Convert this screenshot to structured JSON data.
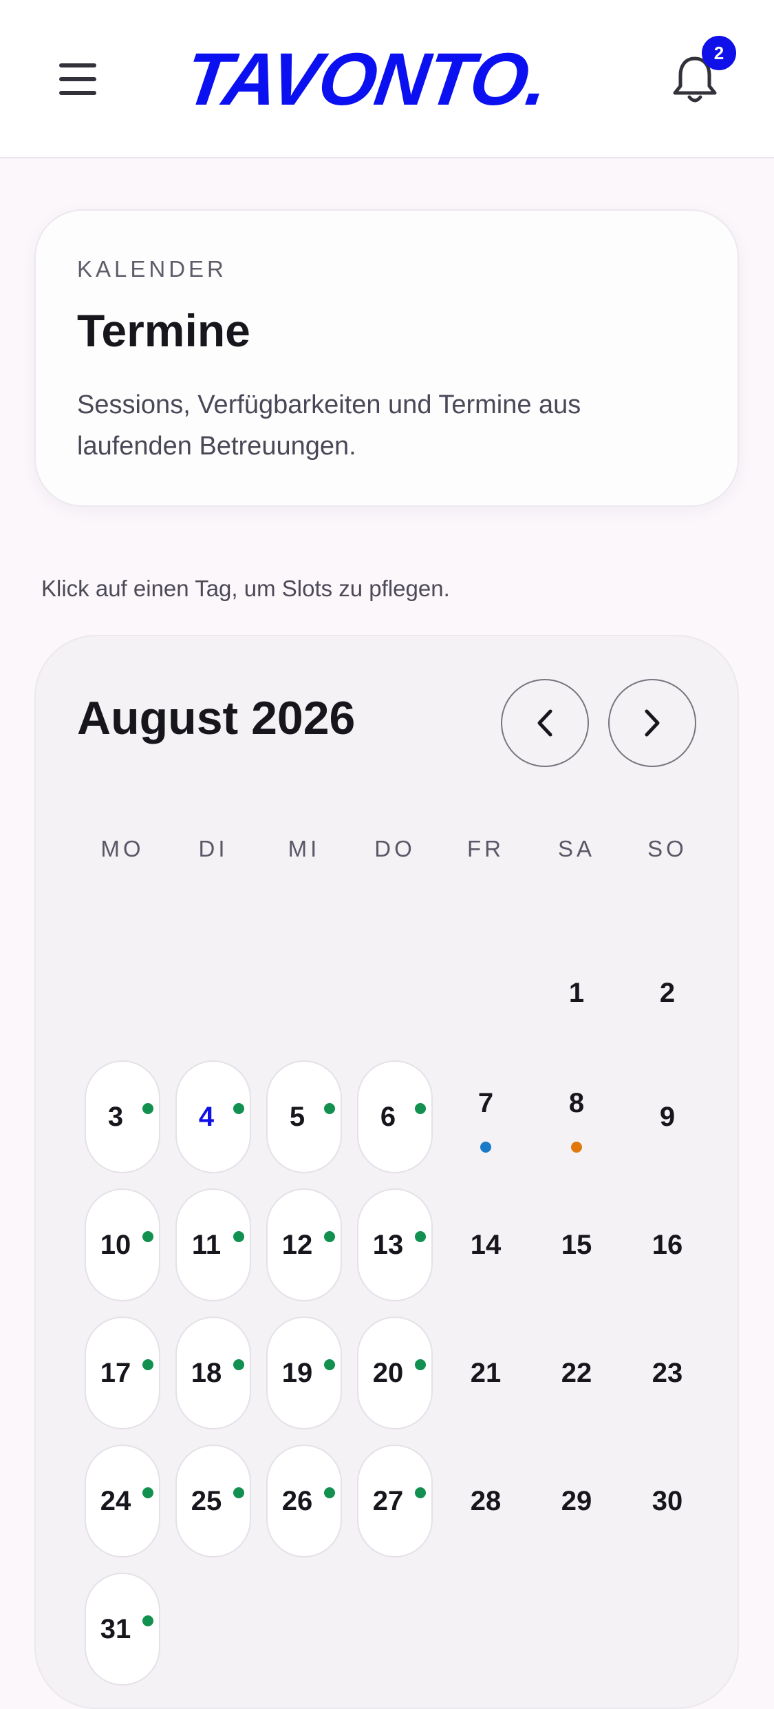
{
  "header": {
    "logo": "TAVONTO.",
    "notification_count": "2"
  },
  "intro": {
    "eyebrow": "KALENDER",
    "title": "Termine",
    "description": "Sessions, Verfügbarkeiten und Termine aus laufenden Betreuungen."
  },
  "hint": "Klick auf einen Tag, um Slots zu pflegen.",
  "calendar": {
    "month_label": "August 2026",
    "weekdays": [
      "MO",
      "DI",
      "MI",
      "DO",
      "FR",
      "SA",
      "SO"
    ],
    "days": [
      {
        "d": "1",
        "pill": false,
        "dot": null
      },
      {
        "d": "2",
        "pill": false,
        "dot": null
      },
      {
        "d": "3",
        "pill": true,
        "dot": "#12904f"
      },
      {
        "d": "4",
        "pill": true,
        "dot": "#12904f",
        "today": true
      },
      {
        "d": "5",
        "pill": true,
        "dot": "#12904f"
      },
      {
        "d": "6",
        "pill": true,
        "dot": "#12904f"
      },
      {
        "d": "7",
        "pill": false,
        "dot": "#1a7ac8"
      },
      {
        "d": "8",
        "pill": false,
        "dot": "#e0780c"
      },
      {
        "d": "9",
        "pill": false,
        "dot": null
      },
      {
        "d": "10",
        "pill": true,
        "dot": "#12904f"
      },
      {
        "d": "11",
        "pill": true,
        "dot": "#12904f"
      },
      {
        "d": "12",
        "pill": true,
        "dot": "#12904f"
      },
      {
        "d": "13",
        "pill": true,
        "dot": "#12904f"
      },
      {
        "d": "14",
        "pill": false,
        "dot": null
      },
      {
        "d": "15",
        "pill": false,
        "dot": null
      },
      {
        "d": "16",
        "pill": false,
        "dot": null
      },
      {
        "d": "17",
        "pill": true,
        "dot": "#12904f"
      },
      {
        "d": "18",
        "pill": true,
        "dot": "#12904f"
      },
      {
        "d": "19",
        "pill": true,
        "dot": "#12904f"
      },
      {
        "d": "20",
        "pill": true,
        "dot": "#12904f"
      },
      {
        "d": "21",
        "pill": false,
        "dot": null
      },
      {
        "d": "22",
        "pill": false,
        "dot": null
      },
      {
        "d": "23",
        "pill": false,
        "dot": null
      },
      {
        "d": "24",
        "pill": true,
        "dot": "#12904f"
      },
      {
        "d": "25",
        "pill": true,
        "dot": "#12904f"
      },
      {
        "d": "26",
        "pill": true,
        "dot": "#12904f"
      },
      {
        "d": "27",
        "pill": true,
        "dot": "#12904f"
      },
      {
        "d": "28",
        "pill": false,
        "dot": null
      },
      {
        "d": "29",
        "pill": false,
        "dot": null
      },
      {
        "d": "30",
        "pill": false,
        "dot": null
      },
      {
        "d": "31",
        "pill": true,
        "dot": "#12904f"
      }
    ]
  },
  "icons": {
    "menu": "hamburger-menu-icon",
    "notifications": "bell-icon",
    "prev": "chevron-left-icon",
    "next": "chevron-right-icon"
  }
}
